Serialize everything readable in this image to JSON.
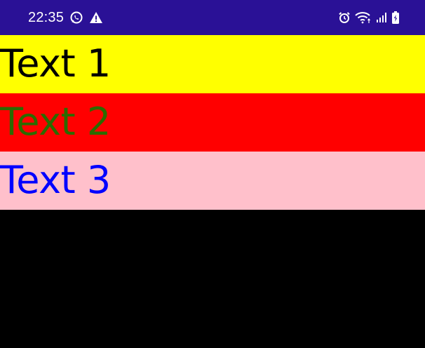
{
  "status_bar": {
    "time": "22:35",
    "background": "#2a1196",
    "icons_left": [
      "whatsapp-icon",
      "warning-icon"
    ],
    "icons_right": [
      "alarm-icon",
      "wifi-icon",
      "signal-icon",
      "battery-icon"
    ]
  },
  "rows": [
    {
      "text": "Text 1",
      "background": "#ffff00",
      "color": "#000000"
    },
    {
      "text": "Text 2",
      "background": "#ff0000",
      "color": "#2b6b00"
    },
    {
      "text": "Text 3",
      "background": "#ffc0cb",
      "color": "#0000ff"
    }
  ],
  "page_background": "#000000"
}
